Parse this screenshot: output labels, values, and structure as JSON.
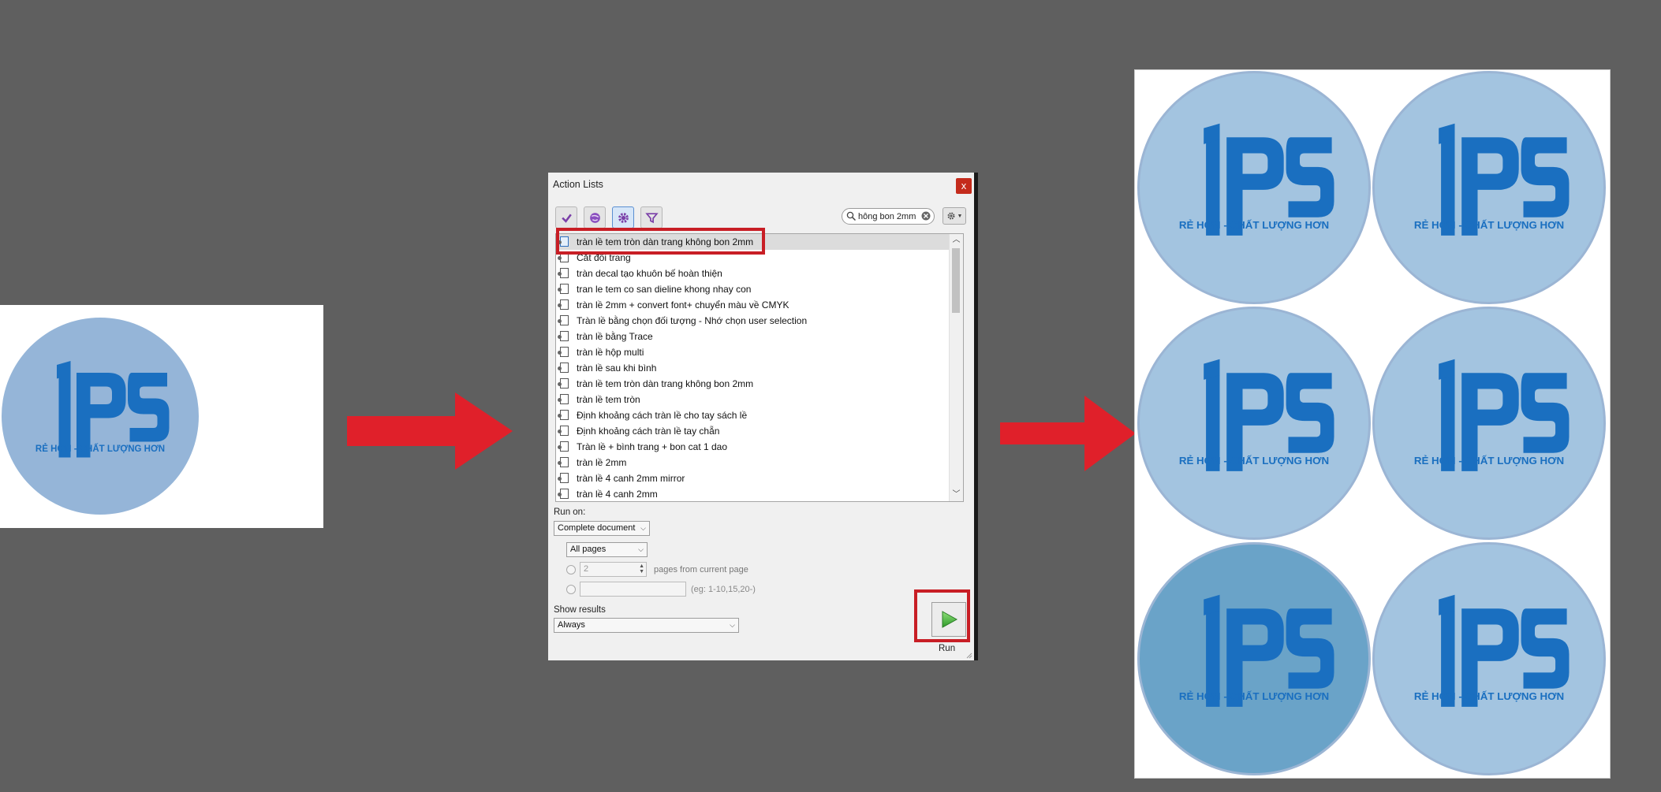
{
  "colors": {
    "background": "#5f5f5f",
    "arrow": "#e0202a",
    "highlight": "#c81e25",
    "sticker_light": "#a3c4e0",
    "sticker_source": "#95b5d8",
    "sticker_dark": "#6aa3c8",
    "logo_blue": "#1a6fc0"
  },
  "logo": {
    "mark": "IPS",
    "tagline": "RẺ HƠN - CHẤT LƯỢNG HƠN"
  },
  "dialog": {
    "title": "Action Lists",
    "close_label": "x",
    "toolbar": {
      "buttons": [
        {
          "icon": "checkmark-icon"
        },
        {
          "icon": "globe-icon"
        },
        {
          "icon": "gear-icon"
        },
        {
          "icon": "filter-icon"
        }
      ],
      "search_value": "hông bon 2mm",
      "settings_icon": "gear-dropdown-icon"
    },
    "list": [
      "tràn lề tem tròn  dàn trang không bon 2mm",
      "Cắt đôi trang",
      "tràn decal tạo khuôn bế hoàn thiện",
      "tran le tem co san dieline khong nhay con",
      "tràn lề 2mm + convert font+ chuyển màu về CMYK",
      "Tràn lề bằng chọn đối tượng - Nhớ chọn user selection",
      "tràn lề bằng Trace",
      "tràn lề hộp multi",
      "tràn lề sau khi bình",
      "tràn lề tem tròn  dàn trang không bon 2mm",
      "tràn lề tem tròn",
      "Định khoảng cách tràn lề cho tay sách lề",
      "Định khoảng cách tràn lề tay chẵn",
      "Tràn lề + bình trang + bon cat 1 dao",
      "tràn lề 2mm",
      "tràn lề 4 canh 2mm mirror",
      "tràn lề 4 canh 2mm"
    ],
    "run_on_label": "Run on:",
    "run_on_value": "Complete document",
    "pages_value": "All pages",
    "pages_count_value": "2",
    "pages_from_label": "pages from current page",
    "range_placeholder": "",
    "range_hint": "(eg: 1-10,15,20-)",
    "show_results_label": "Show results",
    "show_results_value": "Always",
    "run_label": "Run"
  }
}
